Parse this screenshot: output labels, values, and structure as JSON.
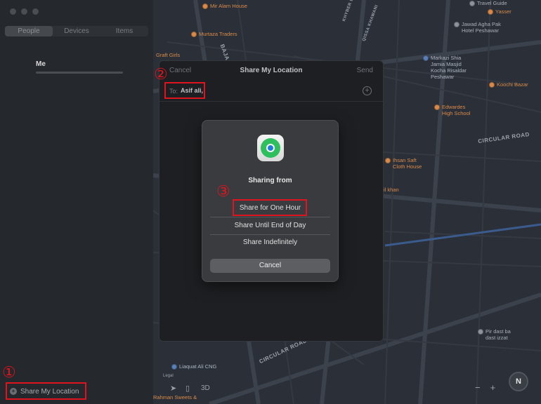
{
  "sidebar": {
    "tabs": [
      {
        "label": "People",
        "active": true
      },
      {
        "label": "Devices",
        "active": false
      },
      {
        "label": "Items",
        "active": false
      }
    ],
    "me_label": "Me",
    "share_button_label": "Share My Location"
  },
  "map": {
    "pois": [
      {
        "label": "Mir Alam House",
        "style": "orange"
      },
      {
        "label": "Murtaza Traders",
        "style": "orange"
      },
      {
        "label": "Graft Girls",
        "style": "orange"
      },
      {
        "label": "Travel Guide",
        "style": "gray"
      },
      {
        "label": "Yasser",
        "style": "orange"
      },
      {
        "label": "Jawad Agha Pak\nHotel Peshawar",
        "style": "gray"
      },
      {
        "label": "Markazi Shia\nJamia Masjid\nKocha Risaldar\nPeshawar",
        "style": "blue"
      },
      {
        "label": "Koochi Bazar",
        "style": "orange"
      },
      {
        "label": "Edwardes\nHigh School",
        "style": "orange"
      },
      {
        "label": "Ihsan Saft\nCloth House",
        "style": "orange"
      },
      {
        "label": "il khan",
        "style": "orange"
      },
      {
        "label": "Pir dast ba\ndast izzat",
        "style": "gray"
      },
      {
        "label": "Liaquat Ali CNG",
        "style": "blue"
      },
      {
        "label": "Rahman Sweets &",
        "style": "orange"
      }
    ],
    "roads": {
      "circular_road": "CIRCULAR ROAD",
      "circular_road_south": "CIRCULAR ROAD",
      "bajar": "BAJA",
      "diagonal1": "QISSA KHAWANI",
      "diagonal2": "KHYBER BAZAR"
    },
    "controls": {
      "legal": "Legal",
      "view_3d": "3D",
      "zoom_out": "−",
      "zoom_in": "+",
      "compass": "N"
    }
  },
  "sheet": {
    "cancel_label": "Cancel",
    "title": "Share My Location",
    "send_label": "Send",
    "to_label": "To:",
    "recipient": "Asif ali,"
  },
  "dialog": {
    "title": "Sharing from",
    "options": [
      "Share for One Hour",
      "Share Until End of Day",
      "Share Indefinitely"
    ],
    "cancel_label": "Cancel"
  },
  "annotations": {
    "step1": "①",
    "step2": "②",
    "step3": "③"
  },
  "colors": {
    "highlight": "#e0141e",
    "poi_orange": "#d98a4a",
    "poi_blue": "#5b7fb8",
    "find_my_green": "#2fbf5f"
  }
}
